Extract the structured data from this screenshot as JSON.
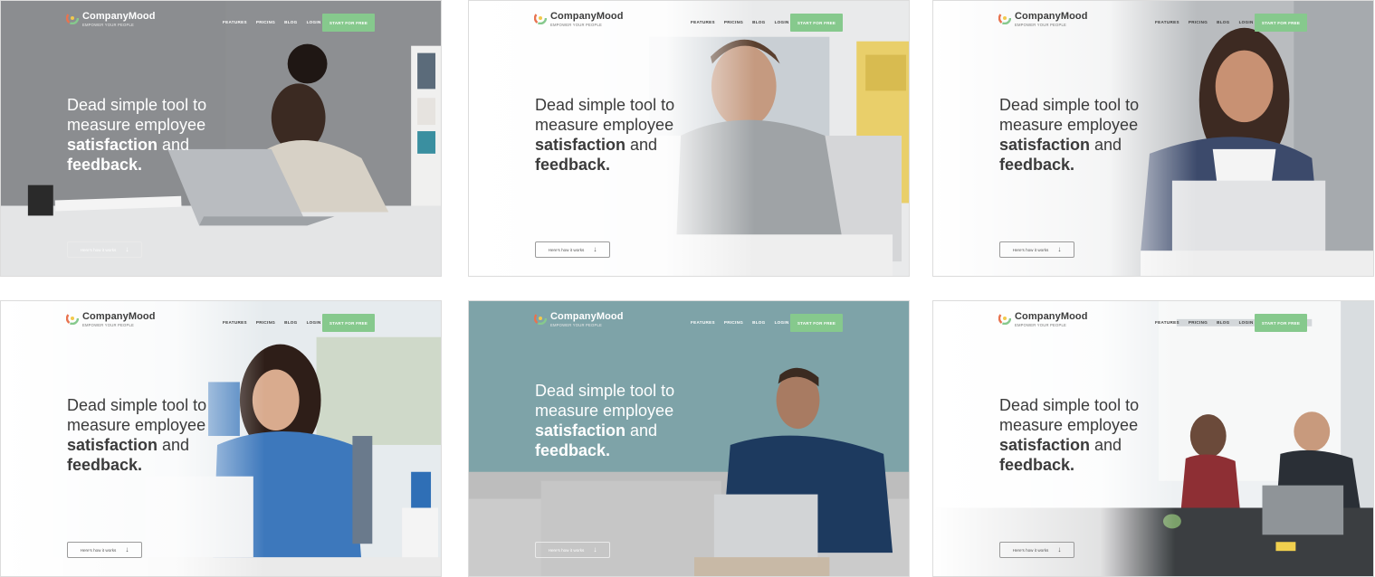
{
  "brand": {
    "name": "CompanyMood",
    "tagline": "EMPOWER YOUR PEOPLE"
  },
  "nav": {
    "links": [
      "FEATURES",
      "PRICING",
      "BLOG",
      "LOGIN"
    ],
    "cta": "START FOR FREE"
  },
  "hero": {
    "line1": "Dead simple tool to",
    "line2": "measure employee",
    "line3_bold": "satisfaction",
    "line3_rest": " and",
    "line4_bold": "feedback."
  },
  "how": {
    "label": "Here's how it works"
  },
  "colors": {
    "accent": "#86c98d",
    "text": "#3b3b3b"
  },
  "icons": [
    "logo-mark-icon",
    "arrow-down-icon"
  ]
}
